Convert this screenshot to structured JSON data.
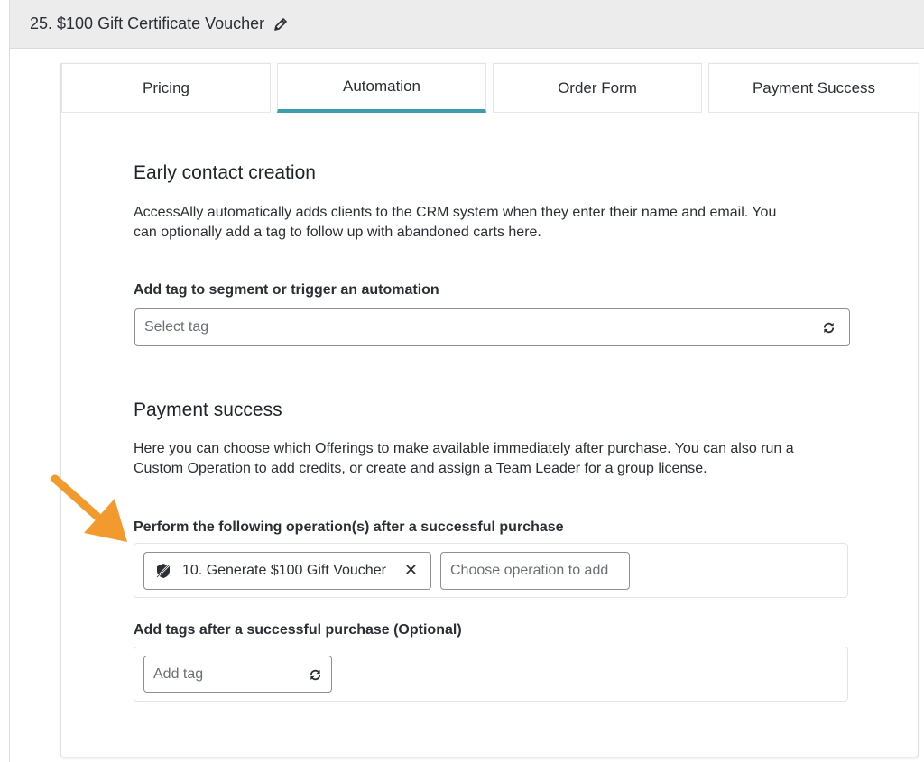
{
  "header": {
    "title": "25.  $100 Gift Certificate Voucher"
  },
  "tabs": [
    {
      "label": "Pricing",
      "active": false
    },
    {
      "label": "Automation",
      "active": true
    },
    {
      "label": "Order Form",
      "active": false
    },
    {
      "label": "Payment Success",
      "active": false
    }
  ],
  "early_contact": {
    "heading": "Early contact creation",
    "description_line1": "AccessAlly automatically adds clients to the CRM system when they enter their name and email. You",
    "description_line2": "can optionally add a tag to follow up with abandoned carts here.",
    "tag_label": "Add tag to segment or trigger an automation",
    "tag_placeholder": "Select tag"
  },
  "payment_success": {
    "heading": "Payment success",
    "description_line1": "Here you can choose which Offerings to make available immediately after purchase. You can also run a",
    "description_line2": "Custom Operation to add credits, or create and assign a Team Leader for a group license.",
    "operations_label": "Perform the following operation(s) after a successful purchase",
    "selected_operation": "10. Generate $100 Gift Voucher",
    "remove_symbol": "✕",
    "operation_placeholder": "Choose operation to add",
    "tags_label": "Add tags after a successful purchase (Optional)",
    "tags_placeholder": "Add tag"
  },
  "colors": {
    "accent_tab": "#3d9dab",
    "arrow": "#f29a2e",
    "title_bar_bg": "#ececec"
  },
  "icons": {
    "title_edit": "pencil-icon",
    "refresh": "refresh-icon",
    "operation": "shield-slash-icon",
    "annotation": "orange-arrow"
  }
}
